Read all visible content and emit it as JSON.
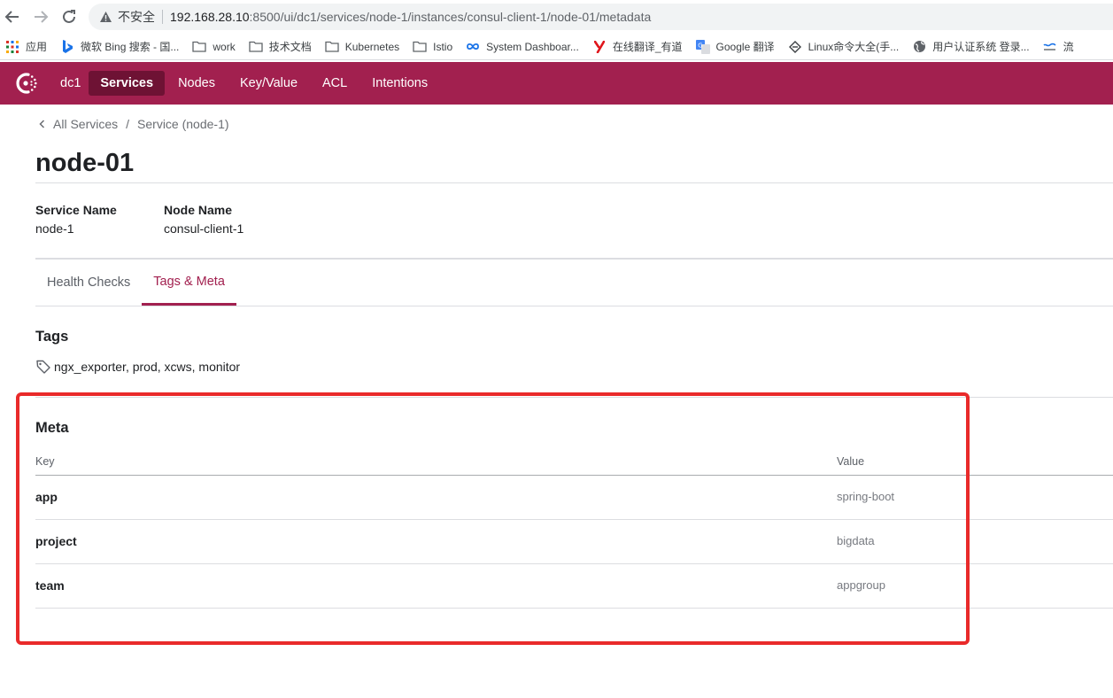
{
  "browser": {
    "insecure_label": "不安全",
    "url_host": "192.168.28.10",
    "url_rest": ":8500/ui/dc1/services/node-1/instances/consul-client-1/node-01/metadata",
    "icons": [
      "back-arrow-icon",
      "forward-arrow-icon",
      "reload-icon",
      "warning-triangle-icon"
    ],
    "bookmarks": [
      {
        "label": "应用",
        "icon": "apps-grid-icon"
      },
      {
        "label": "微软 Bing 搜索 - 国...",
        "icon": "bing-logo-icon"
      },
      {
        "label": "work",
        "icon": "folder-icon"
      },
      {
        "label": "技术文档",
        "icon": "folder-icon"
      },
      {
        "label": "Kubernetes",
        "icon": "folder-icon"
      },
      {
        "label": "Istio",
        "icon": "folder-icon"
      },
      {
        "label": "System Dashboar...",
        "icon": "infinity-icon"
      },
      {
        "label": "在线翻译_有道",
        "icon": "youdao-logo-icon"
      },
      {
        "label": "Google 翻译",
        "icon": "google-translate-icon"
      },
      {
        "label": "Linux命令大全(手...",
        "icon": "diamond-icon"
      },
      {
        "label": "用户认证系统 登录...",
        "icon": "globe-icon"
      },
      {
        "label": "流",
        "icon": "wave-icon"
      }
    ]
  },
  "header": {
    "datacenter": "dc1",
    "menu": [
      {
        "label": "Services",
        "active": true
      },
      {
        "label": "Nodes",
        "active": false
      },
      {
        "label": "Key/Value",
        "active": false
      },
      {
        "label": "ACL",
        "active": false
      },
      {
        "label": "Intentions",
        "active": false
      }
    ],
    "brand_color": "#a2204f",
    "active_color": "#6e1234"
  },
  "breadcrumb": {
    "all_services": "All Services",
    "separator": "/",
    "service": "Service (node-1)"
  },
  "page": {
    "title": "node-01",
    "service_name_label": "Service Name",
    "service_name_value": "node-1",
    "node_name_label": "Node Name",
    "node_name_value": "consul-client-1"
  },
  "tabs": [
    {
      "label": "Health Checks",
      "active": false
    },
    {
      "label": "Tags & Meta",
      "active": true
    }
  ],
  "tags": {
    "title": "Tags",
    "list": "ngx_exporter, prod, xcws, monitor"
  },
  "meta": {
    "title": "Meta",
    "key_header": "Key",
    "value_header": "Value",
    "rows": [
      {
        "key": "app",
        "value": "spring-boot"
      },
      {
        "key": "project",
        "value": "bigdata"
      },
      {
        "key": "team",
        "value": "appgroup"
      }
    ],
    "highlight_color": "#e92a2a"
  }
}
